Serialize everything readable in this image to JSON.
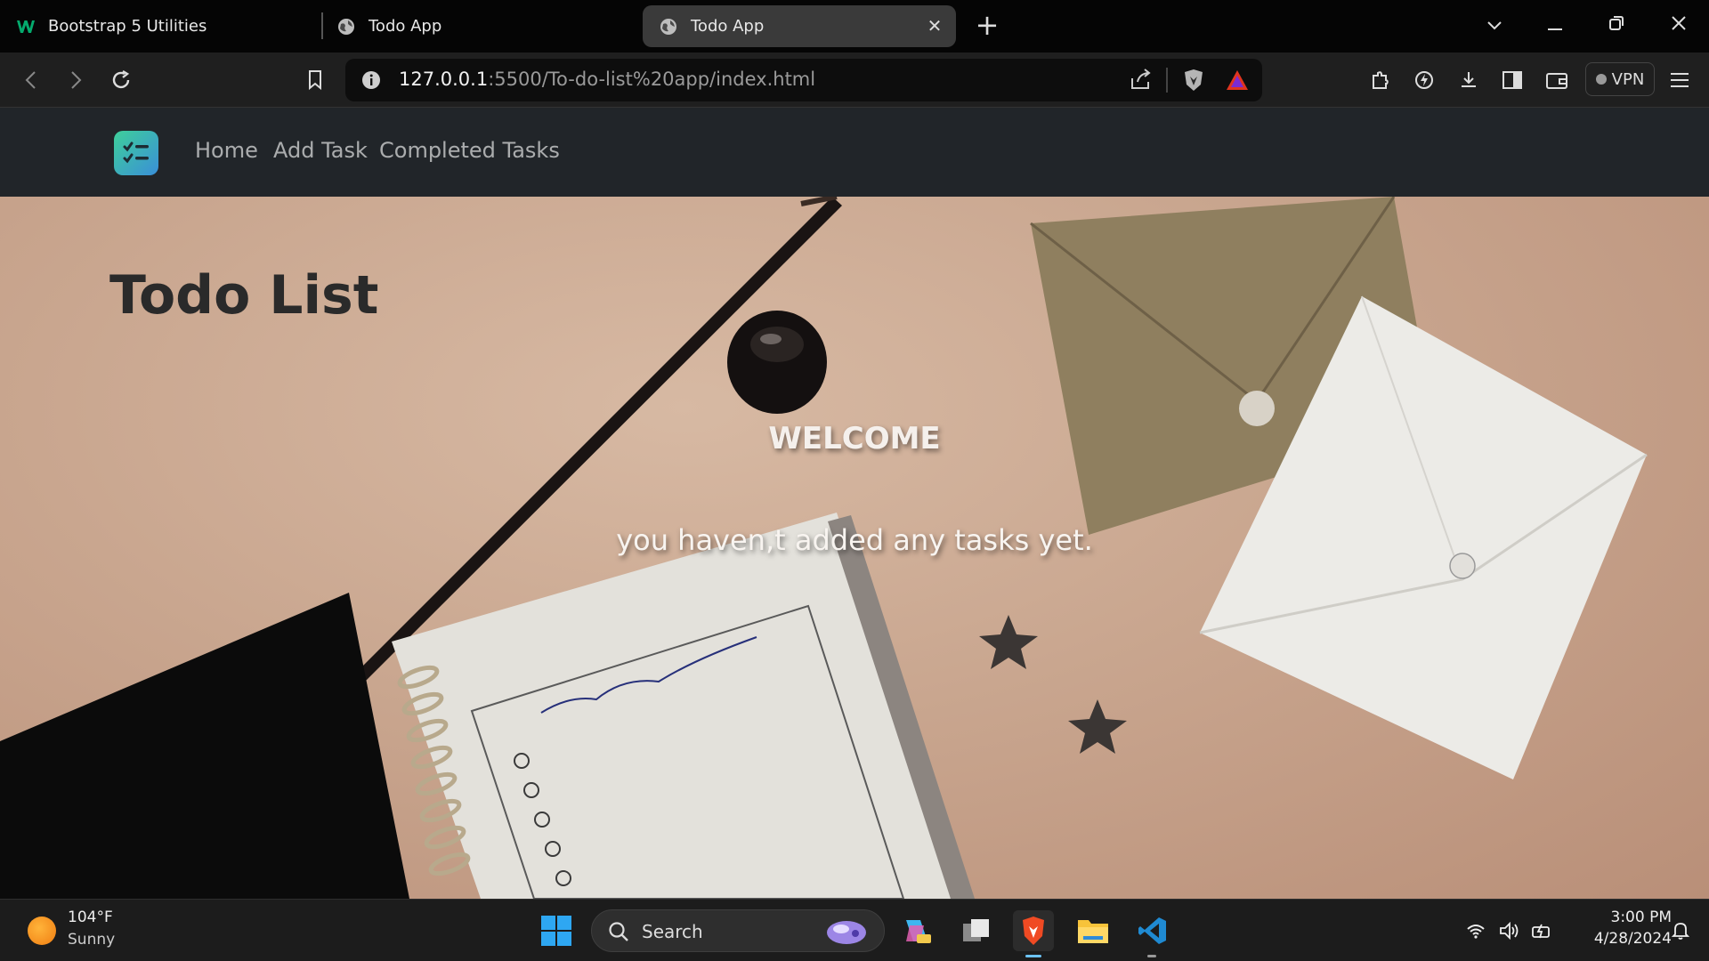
{
  "browser": {
    "tabs": [
      {
        "title": "Bootstrap 5 Utilities",
        "icon": "w3schools-icon"
      },
      {
        "title": "Todo App",
        "icon": "globe-icon"
      },
      {
        "title": "Todo App",
        "icon": "globe-icon",
        "active": true
      }
    ],
    "url_host": "127.0.0.1",
    "url_path": ":5500/To-do-list%20app/index.html",
    "vpn_label": "VPN"
  },
  "navbar": {
    "links": [
      "Home",
      "Add Task",
      "Completed Tasks"
    ]
  },
  "hero": {
    "title": "Todo List",
    "welcome": "WELCOME",
    "empty_message": "you haven,t added any tasks yet."
  },
  "taskbar": {
    "weather_temp": "104°F",
    "weather_condition": "Sunny",
    "search_label": "Search",
    "time": "3:00 PM",
    "date": "4/28/2024"
  },
  "colors": {
    "navbar_bg": "#212529",
    "hero_bg": "#c9a68f",
    "logo_gradient_start": "#3ecf9a",
    "logo_gradient_end": "#3a8fd8"
  }
}
